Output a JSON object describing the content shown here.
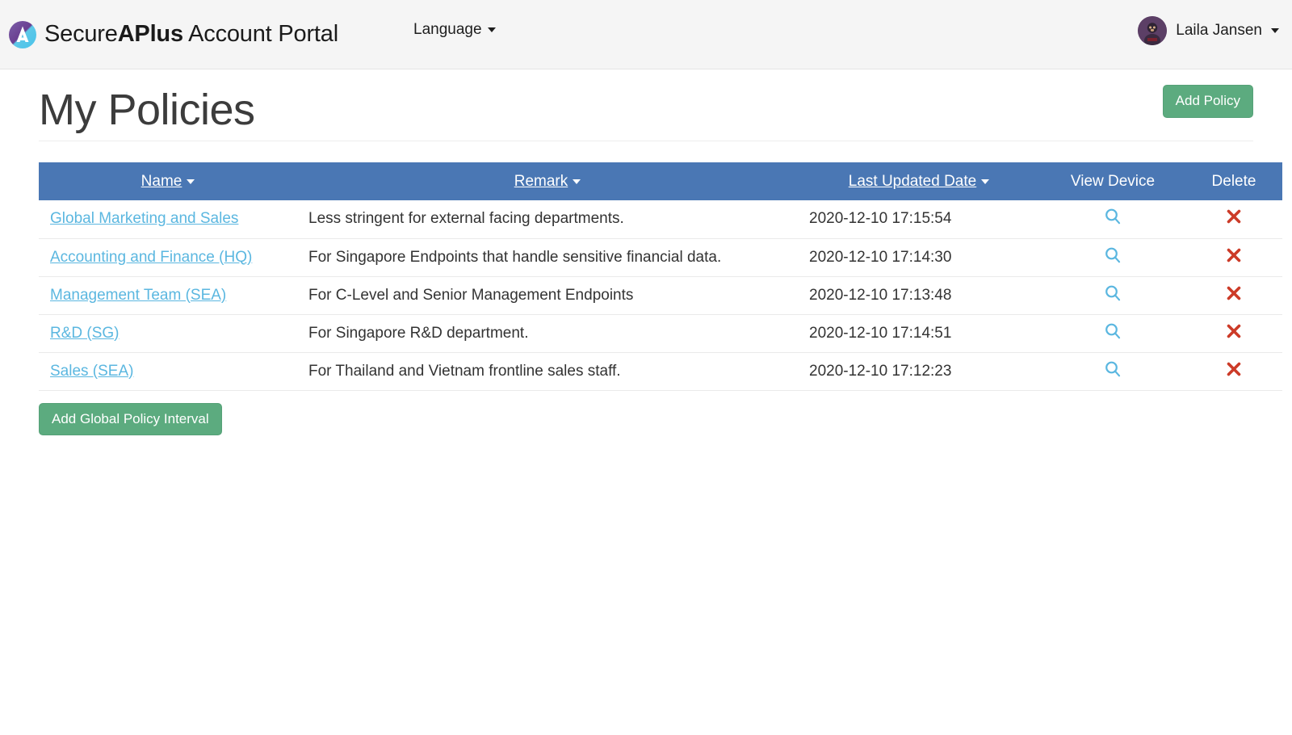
{
  "navbar": {
    "brand_prefix": "Secure",
    "brand_bold": "APlus",
    "brand_suffix": " Account Portal",
    "logo_icon": "secureaplus-logo-icon",
    "language_label": "Language",
    "language_caret_icon": "chevron-down-icon",
    "user_name": "Laila Jansen",
    "user_caret_icon": "chevron-down-icon",
    "avatar_icon": "user-avatar"
  },
  "page": {
    "title": "My Policies",
    "add_policy_label": "Add Policy",
    "add_global_policy_interval_label": "Add Global Policy Interval"
  },
  "colors": {
    "accent_blue": "#4a77b4",
    "accent_green": "#5cab7f",
    "link_blue": "#5bb7e0",
    "delete_red": "#cc3b28",
    "navbar_bg": "#f5f5f5"
  },
  "table": {
    "columns": [
      {
        "key": "name",
        "label": "Name",
        "sortable": true,
        "caret_icon": "chevron-down-icon"
      },
      {
        "key": "remark",
        "label": "Remark",
        "sortable": true,
        "caret_icon": "chevron-down-icon"
      },
      {
        "key": "date",
        "label": "Last Updated Date",
        "sortable": true,
        "caret_icon": "chevron-down-icon"
      },
      {
        "key": "view",
        "label": "View Device",
        "sortable": false
      },
      {
        "key": "delete",
        "label": "Delete",
        "sortable": false
      }
    ],
    "rows": [
      {
        "name": "Global Marketing and Sales",
        "remark": "Less stringent for external facing departments.",
        "date": "2020-12-10 17:15:54",
        "view_icon": "magnifying-glass-icon",
        "delete_icon": "red-cross-icon"
      },
      {
        "name": "Accounting and Finance (HQ)",
        "remark": "For Singapore Endpoints that handle sensitive financial data.",
        "date": "2020-12-10 17:14:30",
        "view_icon": "magnifying-glass-icon",
        "delete_icon": "red-cross-icon"
      },
      {
        "name": "Management Team (SEA)",
        "remark": "For C-Level and Senior Management Endpoints",
        "date": "2020-12-10 17:13:48",
        "view_icon": "magnifying-glass-icon",
        "delete_icon": "red-cross-icon"
      },
      {
        "name": "R&D (SG)",
        "remark": "For Singapore R&D department.",
        "date": "2020-12-10 17:14:51",
        "view_icon": "magnifying-glass-icon",
        "delete_icon": "red-cross-icon"
      },
      {
        "name": "Sales (SEA)",
        "remark": "For Thailand and Vietnam frontline sales staff.",
        "date": "2020-12-10 17:12:23",
        "view_icon": "magnifying-glass-icon",
        "delete_icon": "red-cross-icon"
      }
    ]
  }
}
